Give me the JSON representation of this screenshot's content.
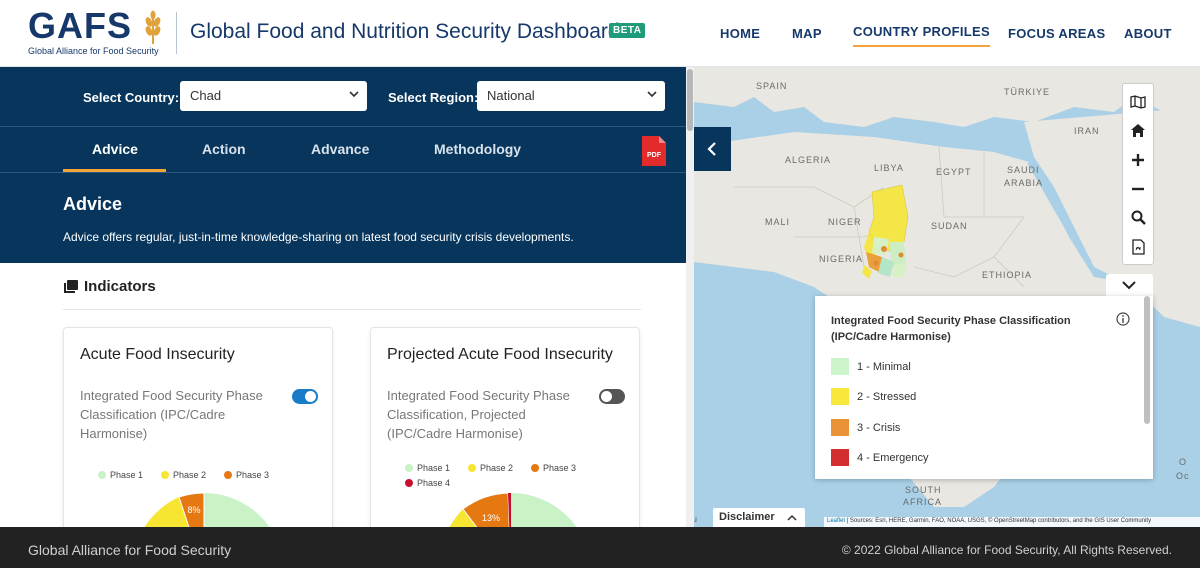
{
  "header": {
    "logo_text": "GAFS",
    "logo_tagline": "Global Alliance for Food Security",
    "title": "Global Food and Nutrition Security Dashboard",
    "badge": "BETA",
    "nav": [
      {
        "label": "HOME",
        "active": false
      },
      {
        "label": "MAP",
        "active": false
      },
      {
        "label": "COUNTRY PROFILES",
        "active": true
      },
      {
        "label": "FOCUS AREAS",
        "active": false
      },
      {
        "label": "ABOUT",
        "active": false
      }
    ]
  },
  "filters": {
    "country_label": "Select Country:",
    "country_value": "Chad",
    "region_label": "Select Region:",
    "region_value": "National"
  },
  "tabs": [
    {
      "label": "Advice",
      "active": true
    },
    {
      "label": "Action",
      "active": false
    },
    {
      "label": "Advance",
      "active": false
    },
    {
      "label": "Methodology",
      "active": false
    }
  ],
  "pdf_label": "PDF",
  "section": {
    "title": "Advice",
    "description": "Advice offers regular, just-in-time knowledge-sharing on latest food security crisis developments."
  },
  "indicators": {
    "heading": "Indicators",
    "cards": [
      {
        "title": "Acute Food Insecurity",
        "description": "Integrated Food Security Phase Classification (IPC/Cadre Harmonise)",
        "toggle_on": true,
        "legend": [
          {
            "label": "Phase 1",
            "color": "#c9f2c7"
          },
          {
            "label": "Phase 2",
            "color": "#f7e531"
          },
          {
            "label": "Phase 3",
            "color": "#e67811"
          }
        ],
        "visible_value": "8%"
      },
      {
        "title": "Projected Acute Food Insecurity",
        "description": "Integrated Food Security Phase Classification, Projected (IPC/Cadre Harmonise)",
        "toggle_on": false,
        "legend": [
          {
            "label": "Phase 1",
            "color": "#c9f2c7"
          },
          {
            "label": "Phase 2",
            "color": "#f7e531"
          },
          {
            "label": "Phase 3",
            "color": "#e67811"
          },
          {
            "label": "Phase 4",
            "color": "#c8102e"
          }
        ],
        "visible_value": "13%"
      }
    ]
  },
  "map": {
    "labels": {
      "spain": "SPAIN",
      "turkiye": "TÜRKIYE",
      "iran": "IRAN",
      "algeria": "ALGERIA",
      "libya": "LIBYA",
      "egypt": "EGYPT",
      "saudi1": "SAUDI",
      "saudi2": "ARABIA",
      "mali": "MALI",
      "niger": "NIGER",
      "sudan": "SUDAN",
      "nigeria": "NIGERIA",
      "ethiopia": "ETHIOPIA",
      "south1": "SOUTH",
      "africa": "AFRICA",
      "ocean1": "O",
      "ocean2": "Oc",
      "edge": "u"
    },
    "controls": [
      "basemap-icon",
      "home-icon",
      "zoom-in-icon",
      "zoom-out-icon",
      "search-icon",
      "export-pdf-icon"
    ],
    "legend": {
      "title": "Integrated Food Security Phase Classification (IPC/Cadre Harmonise)",
      "items": [
        {
          "label": "1 - Minimal",
          "color": "#cdf5cc"
        },
        {
          "label": "2 - Stressed",
          "color": "#f9e83b"
        },
        {
          "label": "3 - Crisis",
          "color": "#ea9236"
        },
        {
          "label": "4 - Emergency",
          "color": "#d42f2f"
        }
      ]
    },
    "disclaimer": "Disclaimer",
    "attribution_leaflet": "Leaflet",
    "attribution": "| Sources: Esri, HERE, Garmin, FAO, NOAA, USGS, © OpenStreetMap contributors, and the GIS User Community"
  },
  "footer": {
    "left": "Global Alliance for Food Security",
    "right": "© 2022 Global Alliance for Food Security, All Rights Reserved."
  }
}
